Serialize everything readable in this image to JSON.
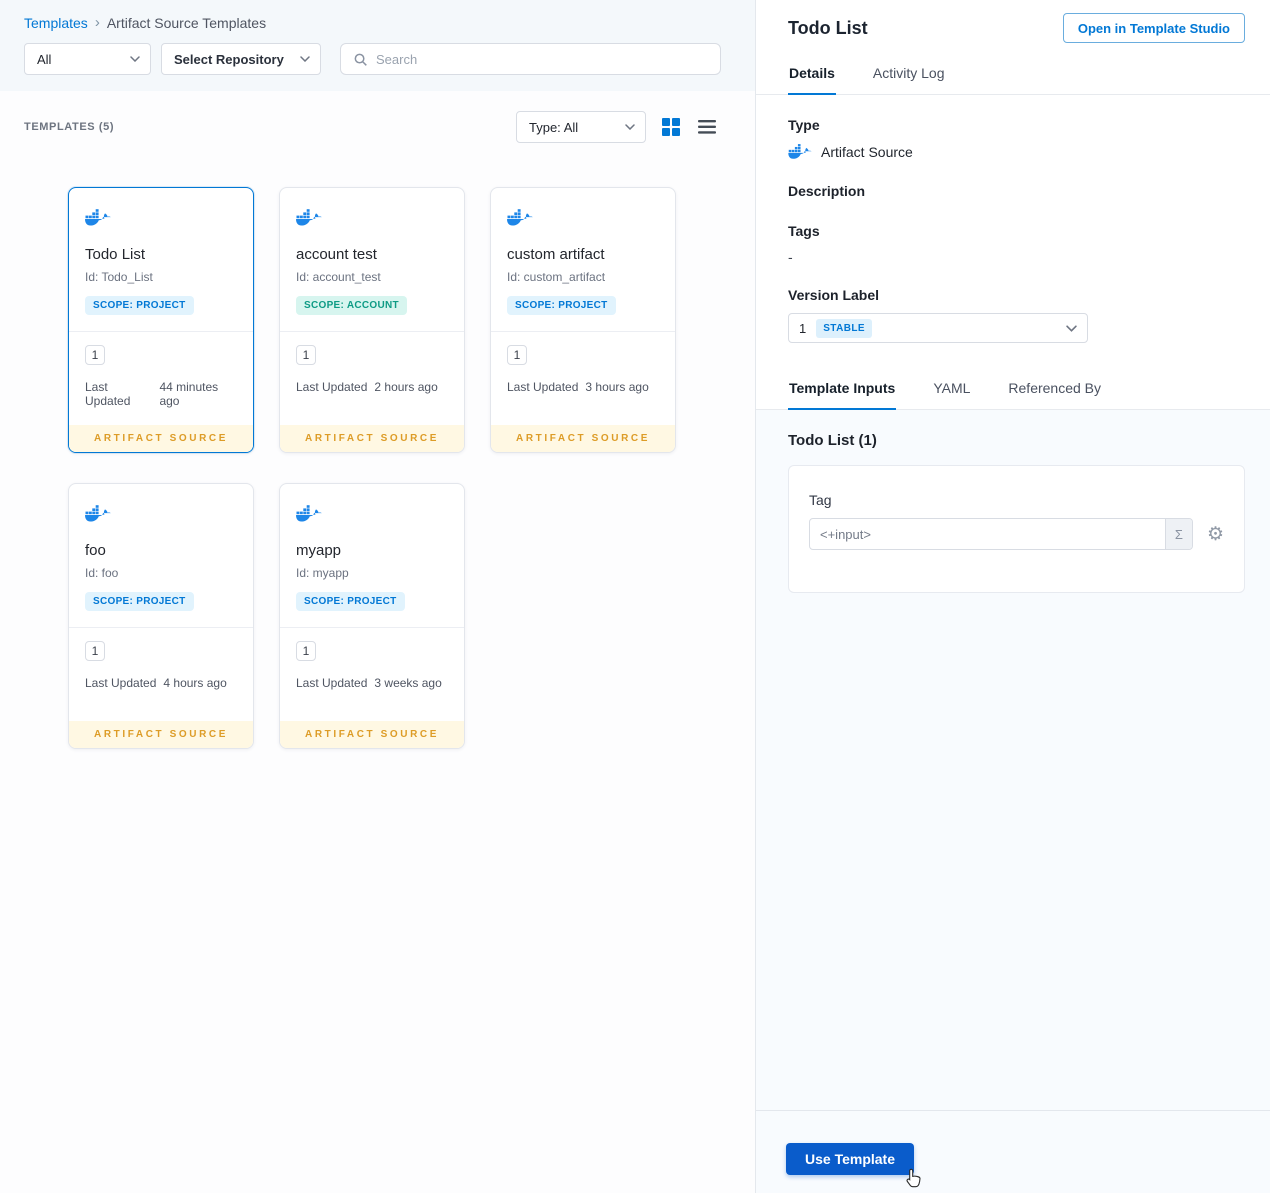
{
  "breadcrumb": {
    "root": "Templates",
    "separator": "›",
    "current": "Artifact Source Templates"
  },
  "filters": {
    "scope": "All",
    "repository": "Select Repository",
    "search_placeholder": "Search"
  },
  "toolbar": {
    "count_label": "TEMPLATES (5)",
    "type_filter": "Type: All"
  },
  "cards": [
    {
      "name": "Todo List",
      "id": "Id: Todo_List",
      "scope": "SCOPE: PROJECT",
      "version": "1",
      "updated_label": "Last Updated",
      "updated": "44 minutes ago",
      "footer": "ARTIFACT SOURCE"
    },
    {
      "name": "account test",
      "id": "Id: account_test",
      "scope": "SCOPE: ACCOUNT",
      "version": "1",
      "updated_label": "Last Updated",
      "updated": "2 hours ago",
      "footer": "ARTIFACT SOURCE"
    },
    {
      "name": "custom artifact",
      "id": "Id: custom_artifact",
      "scope": "SCOPE: PROJECT",
      "version": "1",
      "updated_label": "Last Updated",
      "updated": "3 hours ago",
      "footer": "ARTIFACT SOURCE"
    },
    {
      "name": "foo",
      "id": "Id: foo",
      "scope": "SCOPE: PROJECT",
      "version": "1",
      "updated_label": "Last Updated",
      "updated": "4 hours ago",
      "footer": "ARTIFACT SOURCE"
    },
    {
      "name": "myapp",
      "id": "Id: myapp",
      "scope": "SCOPE: PROJECT",
      "version": "1",
      "updated_label": "Last Updated",
      "updated": "3 weeks ago",
      "footer": "ARTIFACT SOURCE"
    }
  ],
  "panel": {
    "title": "Todo List",
    "open_studio": "Open in Template Studio",
    "tabs": {
      "details": "Details",
      "activity": "Activity Log"
    },
    "details": {
      "type_label": "Type",
      "type_value": "Artifact Source",
      "description_label": "Description",
      "tags_label": "Tags",
      "tags_value": "-",
      "version_label": "Version Label",
      "version_value": "1",
      "version_badge": "STABLE"
    },
    "inner_tabs": {
      "inputs": "Template Inputs",
      "yaml": "YAML",
      "referenced": "Referenced By"
    },
    "inputs": {
      "heading": "Todo List (1)",
      "tag_label": "Tag",
      "tag_value": "<+input>",
      "sigma": "Σ"
    },
    "use_template": "Use Template"
  },
  "icons": {
    "gear": "⚙"
  },
  "colors": {
    "primary": "#0278d5",
    "accent_amber": "#dd9c27",
    "button_blue": "#0a5ccb"
  }
}
